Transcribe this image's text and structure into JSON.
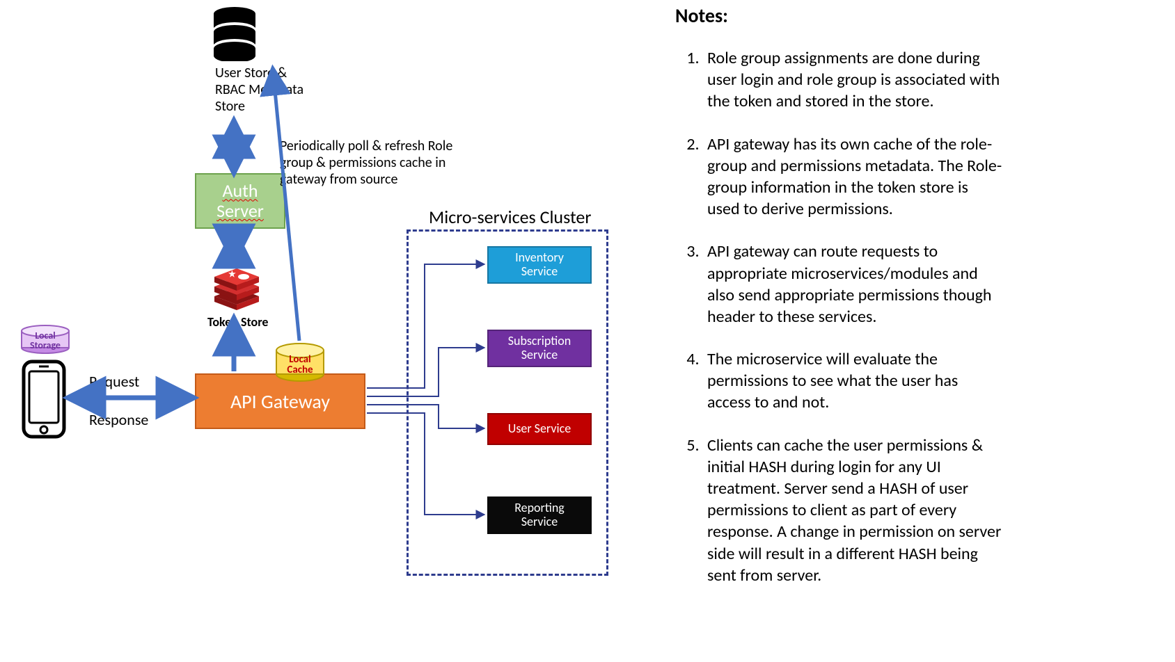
{
  "notes": {
    "title": "Notes:",
    "items": [
      "Role group assignments are done during user login and role group is associated with the token and stored in the store.",
      "API gateway has its own cache of the role-group and permissions metadata.  The Role-group information in the token store is used to derive permissions.",
      "API gateway can route requests to appropriate microservices/modules and also send appropriate permissions though header to these services.",
      "The microservice will evaluate the permissions to see what the user has access to and not.",
      "Clients can cache the user permissions & initial HASH during login for any UI treatment. Server send a HASH of user permissions to client as part of every response. A change in permission on server side will result in a different HASH being sent from server."
    ]
  },
  "diagram": {
    "api_gateway": "API Gateway",
    "auth_server_line1": "Auth",
    "auth_server_line2": "Server",
    "user_store_line1": "User Store &",
    "user_store_line2": "RBAC Metadata",
    "user_store_line3": "Store",
    "token_store": "Token Store",
    "local_cache_line1": "Local",
    "local_cache_line2": "Cache",
    "local_storage_line1": "Local",
    "local_storage_line2": "Storage",
    "poll_line1": "Periodically poll & refresh Role",
    "poll_line2": "group & permissions cache  in",
    "poll_line3": "gateway from source",
    "cluster_title": "Micro-services Cluster",
    "request": "Request",
    "response": "Response",
    "services": {
      "inventory_line1": "Inventory",
      "inventory_line2": "Service",
      "subscription_line1": "Subscription",
      "subscription_line2": "Service",
      "user": "User Service",
      "reporting_line1": "Reporting",
      "reporting_line2": "Service"
    }
  },
  "chart_data": {
    "type": "diagram",
    "nodes": [
      {
        "id": "client",
        "label": "Mobile Client (Local Storage)"
      },
      {
        "id": "api_gateway",
        "label": "API Gateway (Local Cache)"
      },
      {
        "id": "auth_server",
        "label": "Auth Server"
      },
      {
        "id": "user_store",
        "label": "User Store & RBAC Metadata Store"
      },
      {
        "id": "token_store",
        "label": "Token Store"
      },
      {
        "id": "inventory_service",
        "label": "Inventory Service"
      },
      {
        "id": "subscription_service",
        "label": "Subscription Service"
      },
      {
        "id": "user_service",
        "label": "User Service"
      },
      {
        "id": "reporting_service",
        "label": "Reporting Service"
      }
    ],
    "edges": [
      {
        "from": "client",
        "to": "api_gateway",
        "label": "Request / Response",
        "bidirectional": true
      },
      {
        "from": "api_gateway",
        "to": "token_store",
        "bidirectional": false
      },
      {
        "from": "api_gateway",
        "to": "user_store",
        "label": "Periodically poll & refresh Role group & permissions cache in gateway from source",
        "bidirectional": false
      },
      {
        "from": "auth_server",
        "to": "user_store",
        "bidirectional": true
      },
      {
        "from": "auth_server",
        "to": "token_store",
        "bidirectional": true
      },
      {
        "from": "api_gateway",
        "to": "inventory_service"
      },
      {
        "from": "api_gateway",
        "to": "subscription_service"
      },
      {
        "from": "api_gateway",
        "to": "user_service"
      },
      {
        "from": "api_gateway",
        "to": "reporting_service"
      }
    ],
    "clusters": [
      {
        "id": "microservices",
        "label": "Micro-services Cluster",
        "members": [
          "inventory_service",
          "subscription_service",
          "user_service",
          "reporting_service"
        ]
      }
    ]
  }
}
